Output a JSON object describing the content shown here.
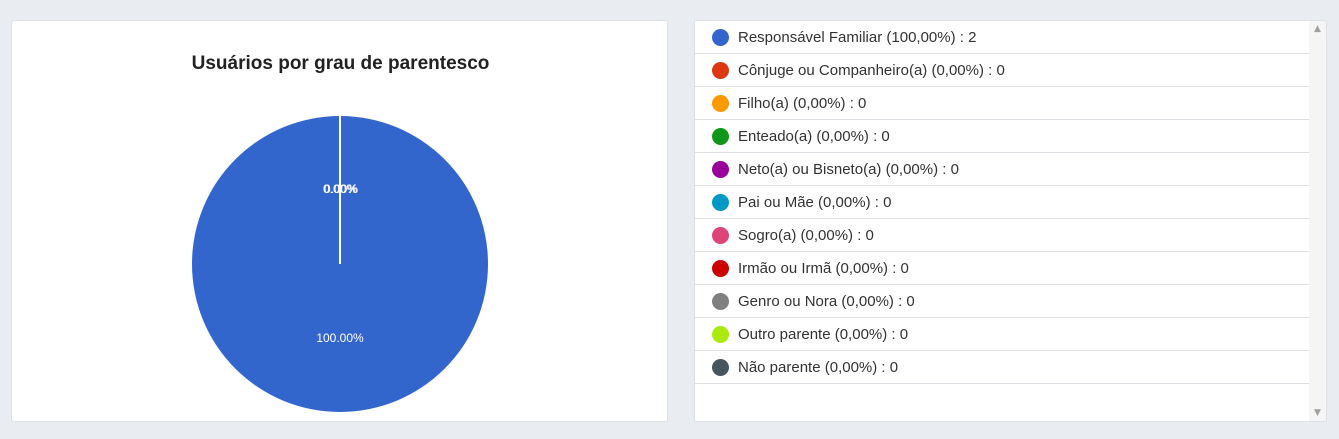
{
  "chart_data": {
    "type": "pie",
    "title": "Usuários por grau de parentesco",
    "slices": [
      {
        "label": "Responsável Familiar",
        "value": 2,
        "percent": "100,00%",
        "color": "#3366cc",
        "pie_label": "100.00%"
      },
      {
        "label": "Cônjuge ou Companheiro(a)",
        "value": 0,
        "percent": "0,00%",
        "color": "#dc3912",
        "pie_label": "0.00%"
      },
      {
        "label": "Filho(a)",
        "value": 0,
        "percent": "0,00%",
        "color": "#ff9900"
      },
      {
        "label": "Enteado(a)",
        "value": 0,
        "percent": "0,00%",
        "color": "#109618"
      },
      {
        "label": "Neto(a) ou Bisneto(a)",
        "value": 0,
        "percent": "0,00%",
        "color": "#990099"
      },
      {
        "label": "Pai ou Mãe",
        "value": 0,
        "percent": "0,00%",
        "color": "#0099c6"
      },
      {
        "label": "Sogro(a)",
        "value": 0,
        "percent": "0,00%",
        "color": "#dd4477"
      },
      {
        "label": "Irmão ou Irmã",
        "value": 0,
        "percent": "0,00%",
        "color": "#cc0000"
      },
      {
        "label": "Genro ou Nora",
        "value": 0,
        "percent": "0,00%",
        "color": "#808080"
      },
      {
        "label": "Outro parente",
        "value": 0,
        "percent": "0,00%",
        "color": "#aaea11"
      },
      {
        "label": "Não parente",
        "value": 0,
        "percent": "0,00%",
        "color": "#47555f"
      }
    ],
    "legend": {
      "items": [
        "Responsável Familiar (100,00%) : 2",
        "Cônjuge ou Companheiro(a) (0,00%) : 0",
        "Filho(a) (0,00%) : 0",
        "Enteado(a) (0,00%) : 0",
        "Neto(a) ou Bisneto(a) (0,00%) : 0",
        "Pai ou Mãe (0,00%) : 0",
        "Sogro(a) (0,00%) : 0",
        "Irmão ou Irmã (0,00%) : 0",
        "Genro ou Nora (0,00%) : 0",
        "Outro parente (0,00%) : 0",
        "Não parente (0,00%) : 0"
      ],
      "placement": "right"
    }
  }
}
